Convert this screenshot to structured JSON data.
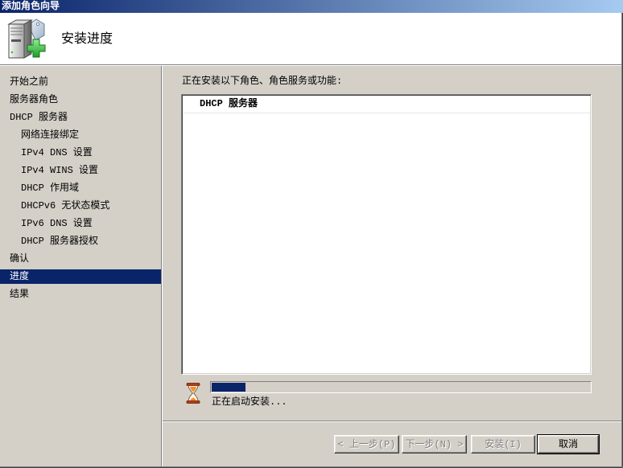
{
  "window": {
    "title": "添加角色向导"
  },
  "header": {
    "title": "安装进度",
    "icon": "server-add-role-icon"
  },
  "nav": {
    "items": [
      {
        "label": "开始之前"
      },
      {
        "label": "服务器角色"
      },
      {
        "label": "DHCP 服务器",
        "children": [
          {
            "label": "网络连接绑定"
          },
          {
            "label": "IPv4 DNS 设置"
          },
          {
            "label": "IPv4 WINS 设置"
          },
          {
            "label": "DHCP 作用域"
          },
          {
            "label": "DHCPv6 无状态模式"
          },
          {
            "label": "IPv6 DNS 设置"
          },
          {
            "label": "DHCP 服务器授权"
          }
        ]
      },
      {
        "label": "确认"
      },
      {
        "label": "进度",
        "selected": true
      },
      {
        "label": "结果"
      }
    ]
  },
  "main": {
    "intro": "正在安装以下角色、角色服务或功能:",
    "roles": [
      {
        "label": "DHCP 服务器"
      }
    ],
    "progress": {
      "percent": 9,
      "status": "正在启动安装...",
      "icon": "hourglass-icon"
    }
  },
  "buttons": {
    "back": {
      "label": "< 上一步(P)",
      "enabled": false
    },
    "next": {
      "label": "下一步(N) >",
      "enabled": false
    },
    "install": {
      "label": "安装(I)",
      "enabled": false
    },
    "cancel": {
      "label": "取消",
      "enabled": true
    }
  },
  "colors": {
    "title_bar_gradient_start": "#0a246a",
    "title_bar_gradient_end": "#a6caf0",
    "selection": "#0a246a",
    "progress_fill": "#0a246a",
    "dialog_face": "#d4d0c8"
  }
}
